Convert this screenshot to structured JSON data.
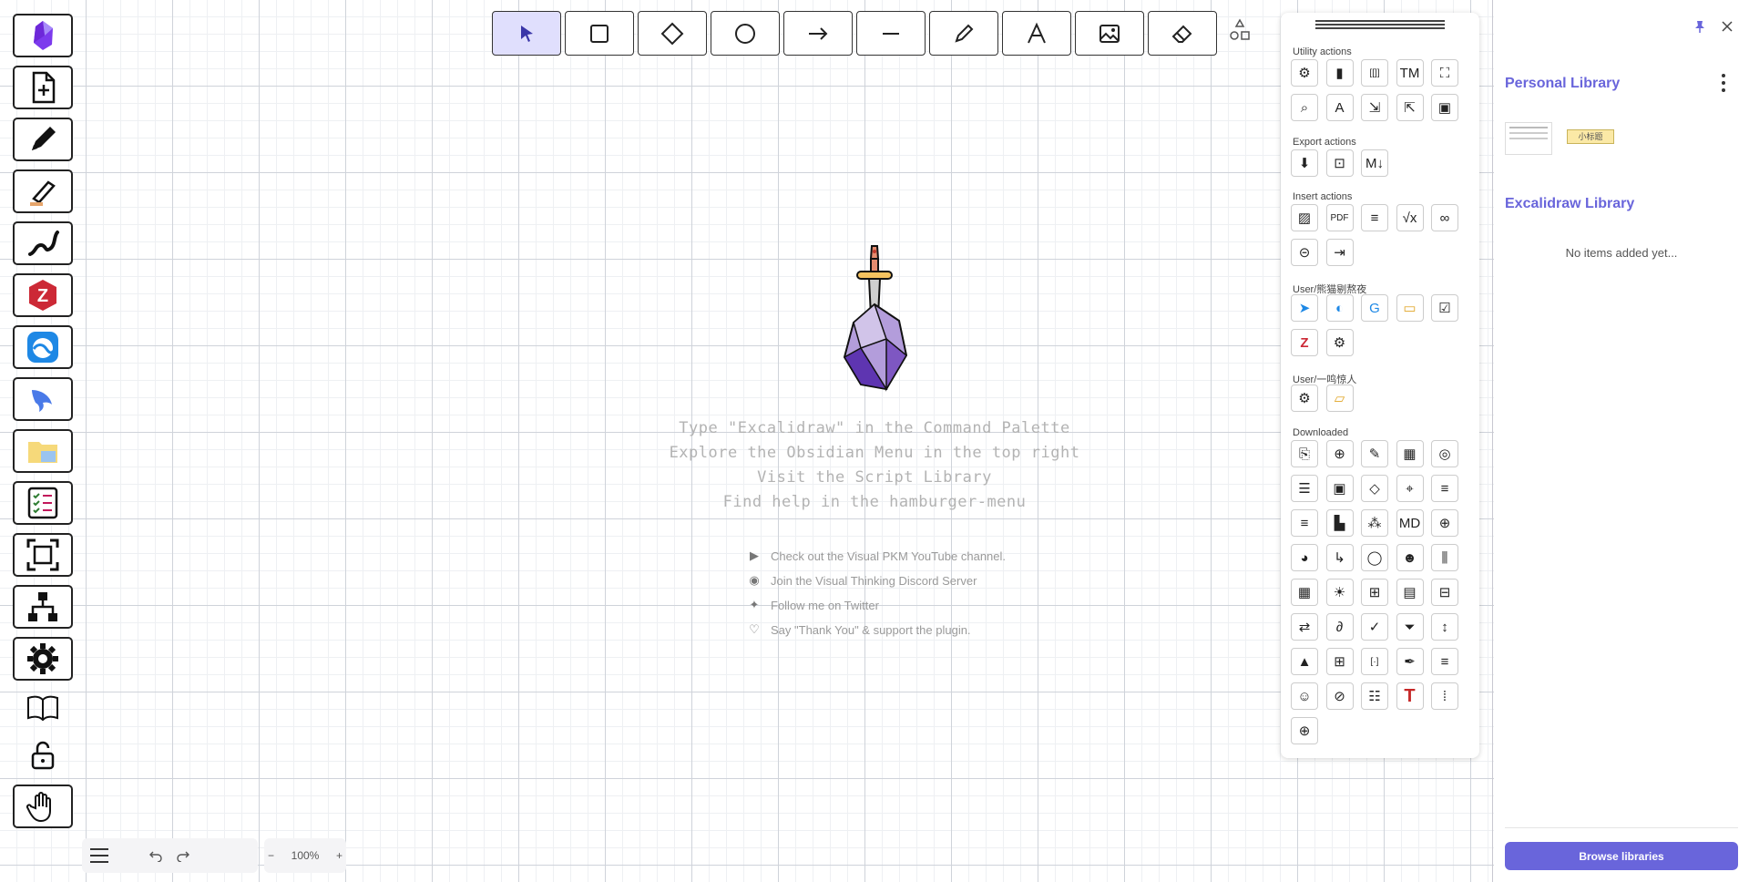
{
  "top_tools": [
    {
      "name": "selection",
      "icon": "cursor-icon",
      "active": true
    },
    {
      "name": "rectangle",
      "icon": "square-icon"
    },
    {
      "name": "diamond",
      "icon": "diamond-icon"
    },
    {
      "name": "ellipse",
      "icon": "circle-icon"
    },
    {
      "name": "arrow",
      "icon": "arrow-right-icon"
    },
    {
      "name": "line",
      "icon": "line-icon"
    },
    {
      "name": "draw",
      "icon": "pencil-icon"
    },
    {
      "name": "text",
      "icon": "text-icon",
      "glyph": "A"
    },
    {
      "name": "image",
      "icon": "image-icon"
    },
    {
      "name": "eraser",
      "icon": "eraser-icon"
    }
  ],
  "welcome": {
    "hints": [
      "Type \"Excalidraw\" in the Command Palette",
      "Explore the Obsidian Menu in the top right",
      "Visit the Script Library",
      "Find help in the hamburger-menu"
    ],
    "links": [
      {
        "icon": "youtube-icon",
        "glyph": "▶",
        "text": "Check out the Visual PKM YouTube channel."
      },
      {
        "icon": "discord-icon",
        "glyph": "◉",
        "text": "Join the Visual Thinking Discord Server"
      },
      {
        "icon": "twitter-icon",
        "glyph": "✦",
        "text": "Follow me on Twitter"
      },
      {
        "icon": "heart-icon",
        "glyph": "♡",
        "text": "Say \"Thank You\" & support the plugin."
      }
    ]
  },
  "panel": {
    "sections": [
      {
        "title": "Utility actions",
        "buttons": [
          {
            "icon": "gear-icon",
            "glyph": "⚙"
          },
          {
            "icon": "book-icon",
            "glyph": "▮"
          },
          {
            "icon": "wiki-link-icon",
            "glyph": "[[]]"
          },
          {
            "icon": "trademark-icon",
            "glyph": "TM"
          },
          {
            "icon": "fullscreen-icon",
            "glyph": "⛶"
          },
          {
            "icon": "search-icon",
            "glyph": "⌕"
          },
          {
            "icon": "ocr-icon",
            "glyph": "A"
          },
          {
            "icon": "open-file-icon",
            "glyph": "⇲"
          },
          {
            "icon": "import-icon",
            "glyph": "⇱"
          },
          {
            "icon": "save-icon",
            "glyph": "▣"
          }
        ]
      },
      {
        "title": "Export actions",
        "buttons": [
          {
            "icon": "download-icon",
            "glyph": "⬇"
          },
          {
            "icon": "export-image-icon",
            "glyph": "⊡"
          },
          {
            "icon": "markdown-icon",
            "glyph": "M↓"
          }
        ]
      },
      {
        "title": "Insert actions",
        "buttons": [
          {
            "icon": "image-icon",
            "glyph": "▨"
          },
          {
            "icon": "pdf-icon",
            "glyph": "PDF"
          },
          {
            "icon": "document-icon",
            "glyph": "≡"
          },
          {
            "icon": "formula-icon",
            "glyph": "√x"
          },
          {
            "icon": "link-icon",
            "glyph": "∞"
          },
          {
            "icon": "embed-icon",
            "glyph": "⊝"
          },
          {
            "icon": "insert-file-icon",
            "glyph": "⇥"
          }
        ]
      },
      {
        "title": "User/熊猫剔熬夜",
        "buttons": [
          {
            "icon": "bird-icon",
            "glyph": "➤"
          },
          {
            "icon": "wave-icon",
            "glyph": "◐"
          },
          {
            "icon": "translate-icon",
            "glyph": "G"
          },
          {
            "icon": "folder-icon",
            "glyph": "▭"
          },
          {
            "icon": "checklist-icon",
            "glyph": "☑"
          },
          {
            "icon": "zotero-icon",
            "glyph": "Z"
          },
          {
            "icon": "gear-icon",
            "glyph": "⚙"
          }
        ]
      },
      {
        "title": "User/一鸣惊人",
        "buttons": [
          {
            "icon": "gear-icon",
            "glyph": "⚙"
          },
          {
            "icon": "folder-open-icon",
            "glyph": "▱"
          }
        ]
      },
      {
        "title": "Downloaded",
        "buttons": [
          {
            "icon": "file-link-icon",
            "glyph": "⎘"
          },
          {
            "icon": "file-add-icon",
            "glyph": "⊕"
          },
          {
            "icon": "brush-icon",
            "glyph": "✎"
          },
          {
            "icon": "table-icon",
            "glyph": "▦"
          },
          {
            "icon": "circles-icon",
            "glyph": "◎"
          },
          {
            "icon": "list-box-icon",
            "glyph": "☰"
          },
          {
            "icon": "frame-icon",
            "glyph": "▣"
          },
          {
            "icon": "connect-icon",
            "glyph": "◇"
          },
          {
            "icon": "target-icon",
            "glyph": "⌖"
          },
          {
            "icon": "list-image-icon",
            "glyph": "≡"
          },
          {
            "icon": "list-check-icon",
            "glyph": "≡"
          },
          {
            "icon": "paint-icon",
            "glyph": "▙"
          },
          {
            "icon": "hierarchy-icon",
            "glyph": "⁂"
          },
          {
            "icon": "md-file-icon",
            "glyph": "MD"
          },
          {
            "icon": "plus-circle-icon",
            "glyph": "⊕"
          },
          {
            "icon": "pizza-icon",
            "glyph": "◕"
          },
          {
            "icon": "elbow-arrow-icon",
            "glyph": "↳"
          },
          {
            "icon": "mindmap-icon",
            "glyph": "◯"
          },
          {
            "icon": "users-icon",
            "glyph": "☻"
          },
          {
            "icon": "columns-icon",
            "glyph": "⫼"
          },
          {
            "icon": "grid-icon",
            "glyph": "▦"
          },
          {
            "icon": "sun-icon",
            "glyph": "☀"
          },
          {
            "icon": "presentation-icon",
            "glyph": "⊞"
          },
          {
            "icon": "page-icon",
            "glyph": "▤"
          },
          {
            "icon": "text-box-icon",
            "glyph": "⊟"
          },
          {
            "icon": "swap-icon",
            "glyph": "⇄"
          },
          {
            "icon": "freehand-icon",
            "glyph": "∂"
          },
          {
            "icon": "double-check-icon",
            "glyph": "✓"
          },
          {
            "icon": "filter-icon",
            "glyph": "⏷"
          },
          {
            "icon": "spacing-icon",
            "glyph": "↕"
          },
          {
            "icon": "road-icon",
            "glyph": "▲"
          },
          {
            "icon": "grid-box-icon",
            "glyph": "⊞"
          },
          {
            "icon": "bracket-icon",
            "glyph": "[·]"
          },
          {
            "icon": "pen-nib-icon",
            "glyph": "✒"
          },
          {
            "icon": "align-left-icon",
            "glyph": "≡"
          },
          {
            "icon": "robot-icon",
            "glyph": "☺"
          },
          {
            "icon": "eye-off-icon",
            "glyph": "⊘"
          },
          {
            "icon": "bullet-list-icon",
            "glyph": "☷"
          },
          {
            "icon": "red-text-icon",
            "glyph": "T"
          },
          {
            "icon": "dots-grid-icon",
            "glyph": "⁞"
          },
          {
            "icon": "zoom-in-icon",
            "glyph": "⊕"
          }
        ]
      }
    ]
  },
  "bottom": {
    "zoom": "100%"
  },
  "library": {
    "personal_title": "Personal Library",
    "item_label": "小标题",
    "excalidraw_title": "Excalidraw Library",
    "empty_text": "No items added yet...",
    "browse_label": "Browse libraries"
  },
  "colors": {
    "accent": "#6965db",
    "active_tool": "#e0dffd"
  }
}
